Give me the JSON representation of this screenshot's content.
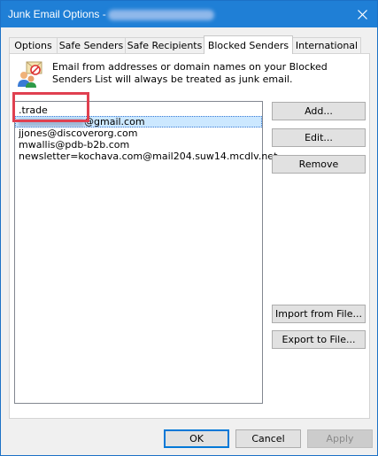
{
  "window": {
    "title": "Junk Email Options - ",
    "close_icon": "close-icon"
  },
  "tabs": [
    {
      "label": "Options",
      "active": false
    },
    {
      "label": "Safe Senders",
      "active": false
    },
    {
      "label": "Safe Recipients",
      "active": false
    },
    {
      "label": "Blocked Senders",
      "active": true
    },
    {
      "label": "International",
      "active": false
    }
  ],
  "info": {
    "icon": "blocked-users-icon",
    "text": "Email from addresses or domain names on your Blocked Senders List will always be treated as junk email."
  },
  "blocked_list": {
    "items": [
      {
        "text": ".trade",
        "selected": false
      },
      {
        "text": "@gmail.com",
        "selected": true
      },
      {
        "text": "jjones@discoverorg.com",
        "selected": false
      },
      {
        "text": "mwallis@pdb-b2b.com",
        "selected": false
      },
      {
        "text": "newsletter=kochava.com@mail204.suw14.mcdlv.net",
        "selected": false
      }
    ]
  },
  "buttons": {
    "add": "Add...",
    "edit": "Edit...",
    "remove": "Remove",
    "import": "Import from File...",
    "export": "Export to File...",
    "ok": "OK",
    "cancel": "Cancel",
    "apply": "Apply"
  },
  "colors": {
    "titlebar": "#1f7fd6",
    "selection": "#cce8ff",
    "highlight": "#e04050",
    "accent": "#0078d7"
  }
}
